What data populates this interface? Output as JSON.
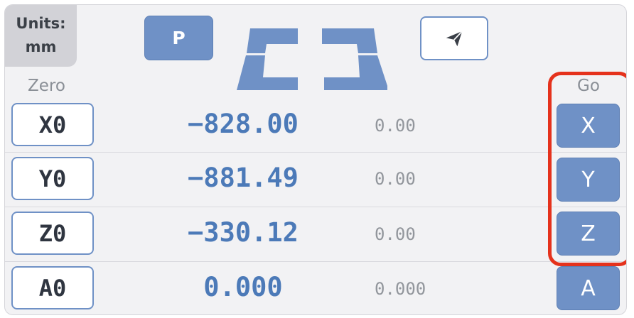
{
  "units": {
    "label": "Units:",
    "value": "mm"
  },
  "toolbar": {
    "p_label": "P",
    "send_icon": "paper-plane-icon",
    "logo_icon": "bracket-logo-icon"
  },
  "headers": {
    "zero": "Zero",
    "go": "Go"
  },
  "axes": [
    {
      "zero_label": "X0",
      "position": "−828.00",
      "machine": "0.00",
      "go_label": "X"
    },
    {
      "zero_label": "Y0",
      "position": "−881.49",
      "machine": "0.00",
      "go_label": "Y"
    },
    {
      "zero_label": "Z0",
      "position": "−330.12",
      "machine": "0.00",
      "go_label": "Z"
    },
    {
      "zero_label": "A0",
      "position": "0.000",
      "machine": "0.000",
      "go_label": "A"
    }
  ],
  "colors": {
    "accent": "#6f91c6",
    "position_text": "#4c7ab8",
    "highlight": "#e5321c",
    "panel_bg": "#f2f2f4"
  }
}
